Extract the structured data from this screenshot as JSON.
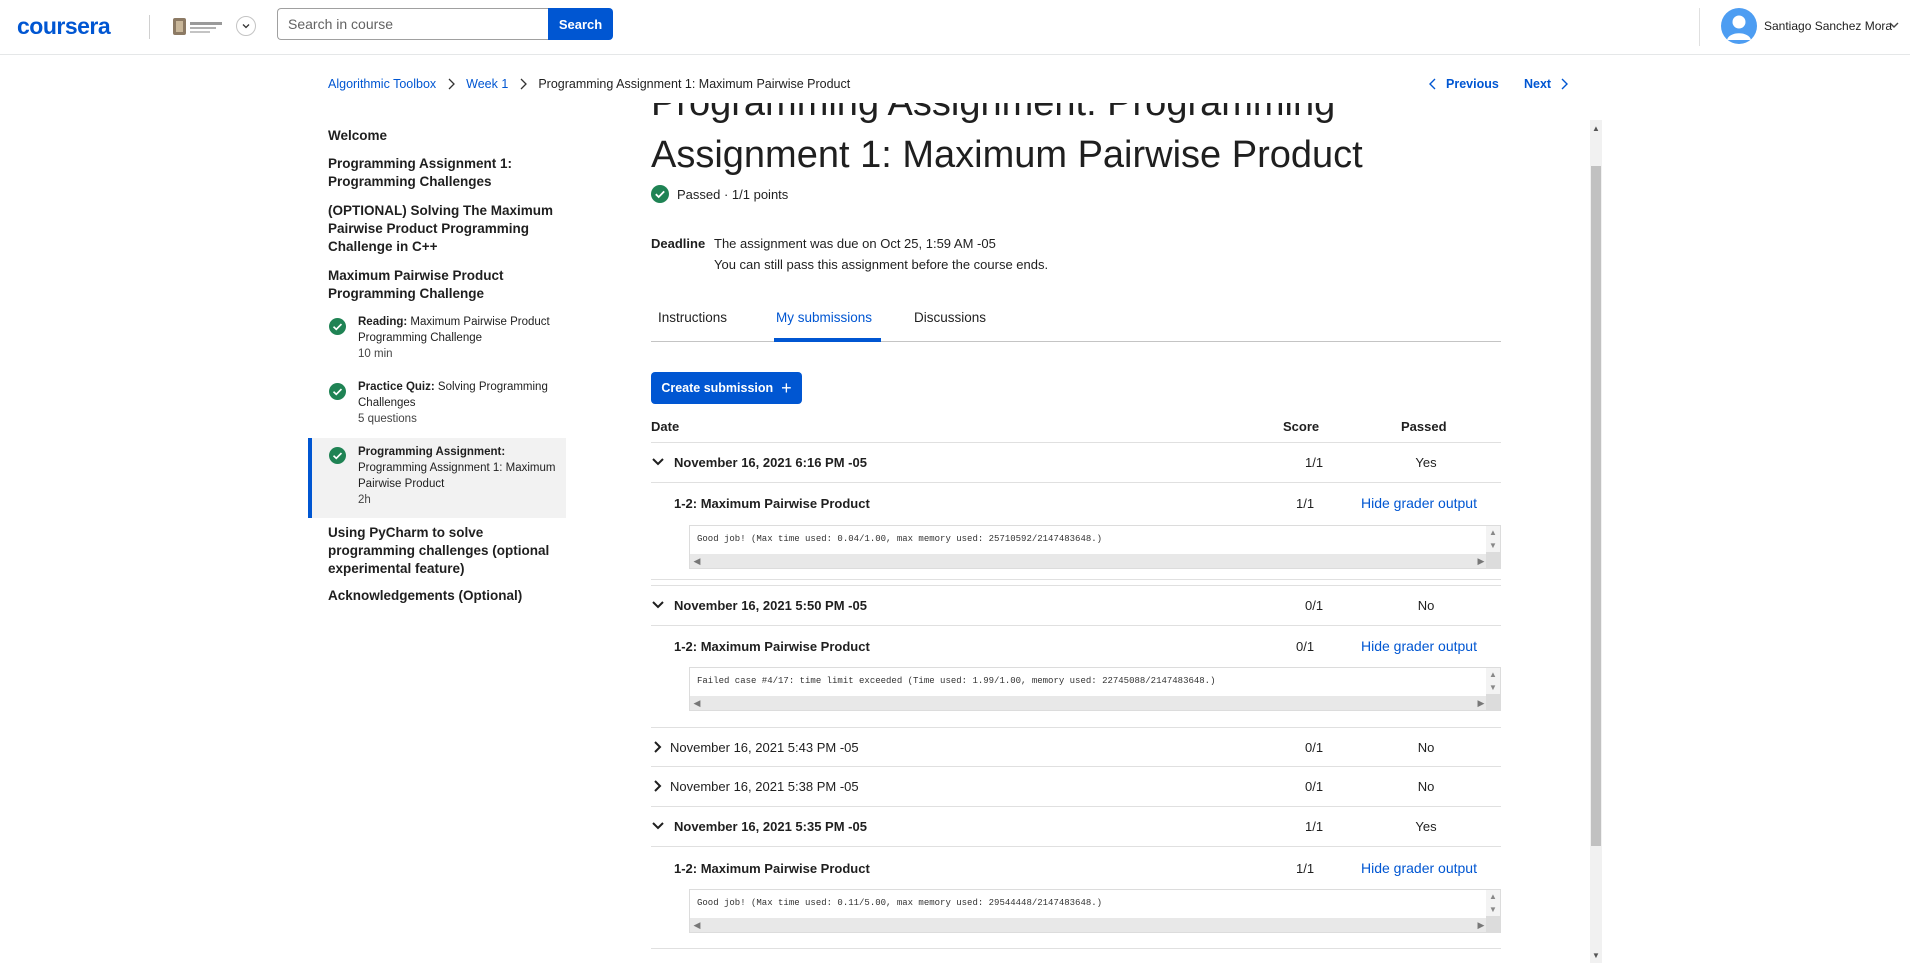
{
  "header": {
    "logo_text": "coursera",
    "search": {
      "placeholder": "Search in course",
      "button_label": "Search"
    },
    "user": {
      "name": "Santiago Sanchez Mora"
    }
  },
  "breadcrumb": {
    "items": [
      "Algorithmic Toolbox",
      "Week 1"
    ],
    "current": "Programming Assignment 1: Maximum Pairwise Product",
    "previous_label": "Previous",
    "next_label": "Next"
  },
  "sidebar": {
    "sections": [
      "Welcome",
      "Programming Assignment 1: Programming Challenges",
      "(OPTIONAL) Solving The Maximum Pairwise Product Programming Challenge in C++",
      "Maximum Pairwise Product Programming Challenge"
    ],
    "items": [
      {
        "type": "Reading:",
        "title": "Maximum Pairwise Product Programming Challenge",
        "meta": "10 min",
        "completed": true
      },
      {
        "type": "Practice Quiz:",
        "title": "Solving Programming Challenges",
        "meta": "5 questions",
        "completed": true
      },
      {
        "type": "Programming Assignment:",
        "title": "Programming Assignment 1: Maximum Pairwise Product",
        "meta": "2h",
        "completed": true,
        "active": true
      }
    ],
    "after_sections": [
      "Using PyCharm to solve programming challenges (optional experimental feature)",
      "Acknowledgements (Optional)"
    ]
  },
  "main": {
    "title_top_clipped": "Programming Assignment: Programming",
    "title": "Assignment 1: Maximum Pairwise Product",
    "status": "Passed · 1/1 points",
    "deadline": {
      "label": "Deadline",
      "line1": "The assignment was due on Oct 25, 1:59 AM -05",
      "line2": "You can still pass this assignment before the course ends."
    },
    "tabs": [
      "Instructions",
      "My submissions",
      "Discussions"
    ],
    "active_tab": "My submissions",
    "create_button": "Create submission",
    "table_headers": {
      "date": "Date",
      "score": "Score",
      "passed": "Passed"
    },
    "submissions": [
      {
        "date": "November 16, 2021 6:16 PM -05",
        "score": "1/1",
        "passed": "Yes",
        "expanded": true,
        "part": {
          "name": "1-2: Maximum Pairwise Product",
          "score": "1/1",
          "link": "Hide grader output",
          "output": "Good job! (Max time used: 0.04/1.00, max memory used: 25710592/2147483648.)"
        }
      },
      {
        "date": "November 16, 2021 5:50 PM -05",
        "score": "0/1",
        "passed": "No",
        "expanded": true,
        "part": {
          "name": "1-2: Maximum Pairwise Product",
          "score": "0/1",
          "link": "Hide grader output",
          "output": "Failed case #4/17: time limit exceeded (Time used: 1.99/1.00, memory used: 22745088/2147483648.)"
        }
      },
      {
        "date": "November 16, 2021 5:43 PM -05",
        "score": "0/1",
        "passed": "No",
        "expanded": false
      },
      {
        "date": "November 16, 2021 5:38 PM -05",
        "score": "0/1",
        "passed": "No",
        "expanded": false
      },
      {
        "date": "November 16, 2021 5:35 PM -05",
        "score": "1/1",
        "passed": "Yes",
        "expanded": true,
        "part": {
          "name": "1-2: Maximum Pairwise Product",
          "score": "1/1",
          "link": "Hide grader output",
          "output": "Good job! (Max time used: 0.11/5.00, max memory used: 29544448/2147483648.)"
        }
      }
    ]
  },
  "colors": {
    "brand": "#0056d2",
    "success": "#1f8354"
  }
}
